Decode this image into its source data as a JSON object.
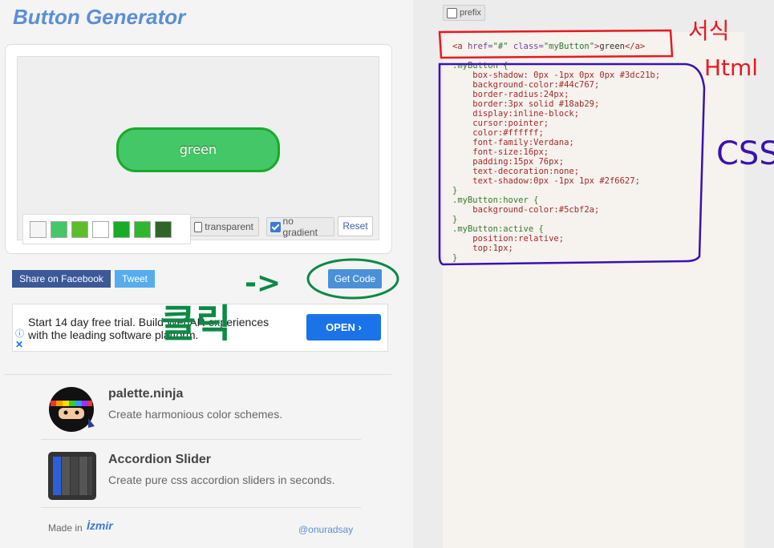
{
  "app": {
    "title": "Button Generator"
  },
  "preview": {
    "button_label": "green",
    "swatches": [
      {
        "name": "swatch-light-gray",
        "color": "#f5f5f5"
      },
      {
        "name": "swatch-green",
        "color": "#44c767"
      },
      {
        "name": "swatch-lime",
        "color": "#5cbf2a"
      },
      {
        "name": "swatch-white",
        "color": "#ffffff"
      },
      {
        "name": "swatch-dark-green",
        "color": "#18ab29"
      },
      {
        "name": "swatch-bright-green",
        "color": "#2fb72f"
      },
      {
        "name": "swatch-forest",
        "color": "#2f6627"
      }
    ],
    "transparent_label": "transparent",
    "transparent_checked": false,
    "no_gradient_label": "no gradient",
    "no_gradient_checked": true,
    "reset_label": "Reset"
  },
  "share": {
    "facebook_label": "Share on Facebook",
    "tweet_label": "Tweet",
    "get_code_label": "Get Code"
  },
  "ad": {
    "text": "Start 14 day free trial. Build WebAR experiences with the leading software platform.",
    "open_label": "OPEN ›",
    "info_icon": "ⓘ",
    "close_icon": "✕"
  },
  "promos": [
    {
      "name": "palette.ninja",
      "desc": "Create harmonious color schemes."
    },
    {
      "name": "Accordion Slider",
      "desc": "Create pure css accordion sliders in seconds."
    }
  ],
  "footer": {
    "made_in": "Made in",
    "logo_text": "İzmir",
    "handle": "@onuradsay"
  },
  "code_panel": {
    "prefix_label": "prefix",
    "html_line": {
      "open": "<a ",
      "href_attr": "href=",
      "href_val": "\"#\"",
      "class_attr": "class=",
      "class_val": "\"myButton\"",
      "text": "green",
      "close": "</a>"
    },
    "css_lines": [
      ".myButton {",
      "\tbox-shadow: 0px -1px 0px 0px #3dc21b;",
      "\tbackground-color:#44c767;",
      "\tborder-radius:24px;",
      "\tborder:3px solid #18ab29;",
      "\tdisplay:inline-block;",
      "\tcursor:pointer;",
      "\tcolor:#ffffff;",
      "\tfont-family:Verdana;",
      "\tfont-size:16px;",
      "\tpadding:15px 76px;",
      "\ttext-decoration:none;",
      "\ttext-shadow:0px -1px 1px #2f6627;",
      "}",
      ".myButton:hover {",
      "\tbackground-color:#5cbf2a;",
      "}",
      ".myButton:active {",
      "\tposition:relative;",
      "\ttop:1px;",
      "}"
    ]
  },
  "annotations": {
    "html_label_line1": "서식",
    "html_label_line2": "Html",
    "css_label": "CSS",
    "click_label": "클릭",
    "arrow": "->",
    "red": "#e8191f",
    "purple": "#3a12b0",
    "green": "#0b8a45"
  }
}
